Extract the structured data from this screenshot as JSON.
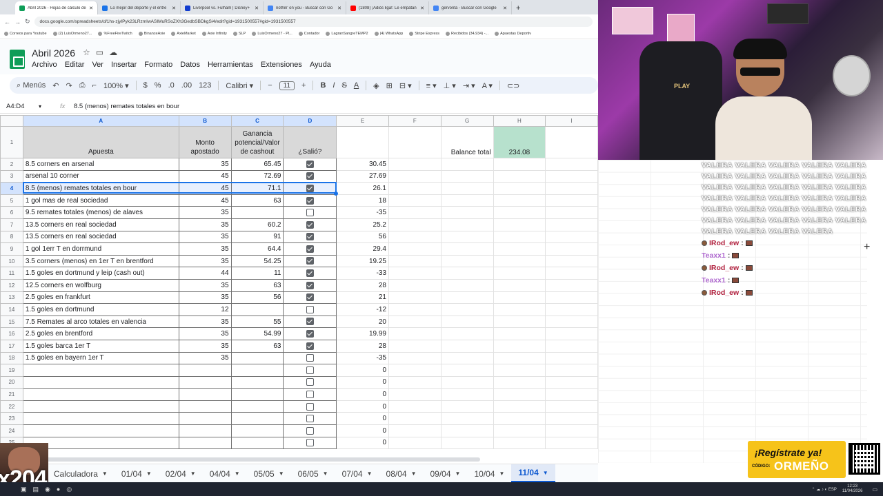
{
  "browser": {
    "tabs": [
      {
        "title": "Abril 2026 - Hojas de cálculo de",
        "active": true
      },
      {
        "title": "Lo mejor del deporte y el entre",
        "active": false
      },
      {
        "title": "Liverpool vs. Fulham | Disney+",
        "active": false
      },
      {
        "title": "nothin' on you - Buscar con Go",
        "active": false
      },
      {
        "title": "(1808) ¡Adiós liga!: Le empatan",
        "active": false
      },
      {
        "title": "gervonta - Buscar con Google",
        "active": false
      }
    ],
    "url": "docs.google.com/spreadsheets/d/1hs-zjyIPyk23LRzmIwASIMuRSoZXh3GedbSBDkgSi4/edit?gid=1931500557#gid=1931500557",
    "bookmarks": [
      "Correos para Youtube",
      "(2) LuisOrmeno27...",
      "%FreeFireTwitch",
      "BinanceAxie",
      "AxieMarket",
      "Axie Infinity",
      "SLP",
      "LuisOrmeno27 - Pl...",
      "Contador",
      "LagranSangreTEMP2",
      "(4) WhatsApp",
      "Stripe Express",
      "Recibidos (34,934) -...",
      "Apuestas Deportiv"
    ]
  },
  "doc": {
    "title": "Abril 2026",
    "menu": [
      "Archivo",
      "Editar",
      "Ver",
      "Insertar",
      "Formato",
      "Datos",
      "Herramientas",
      "Extensiones",
      "Ayuda"
    ]
  },
  "toolbar": {
    "search": "Menús",
    "zoom": "100%",
    "currency": "$",
    "percent": "%",
    "dec_less": ".0",
    "dec_more": ".00",
    "num_format": "123",
    "font": "Calibri",
    "font_size": "11",
    "bold": "B",
    "italic": "I",
    "underline": "A"
  },
  "formula_bar": {
    "cell_ref": "A4:D4",
    "fx": "fx",
    "content": "8.5 (menos) remates totales en bour"
  },
  "grid": {
    "columns": [
      "A",
      "B",
      "C",
      "D",
      "E",
      "F",
      "G",
      "H",
      "I"
    ],
    "header_row": {
      "row": "1",
      "apuesta": "Apuesta",
      "monto": "Monto apostado",
      "ganancia": "Ganancia potencial/Valor de cashout",
      "salio": "¿Salió?",
      "balance_label": "Balance total",
      "balance_value": "234.08"
    },
    "rows": [
      {
        "row": "2",
        "apuesta": "8.5 corners en arsenal",
        "monto": "35",
        "ganancia": "65.45",
        "salio": true,
        "e": "30.45"
      },
      {
        "row": "3",
        "apuesta": "arsenal 10 corner",
        "monto": "45",
        "ganancia": "72.69",
        "salio": true,
        "e": "27.69"
      },
      {
        "row": "4",
        "apuesta": "8.5 (menos) remates totales en bour",
        "monto": "45",
        "ganancia": "71.1",
        "salio": true,
        "e": "26.1"
      },
      {
        "row": "5",
        "apuesta": "1 gol mas de real sociedad",
        "monto": "45",
        "ganancia": "63",
        "salio": true,
        "e": "18"
      },
      {
        "row": "6",
        "apuesta": "9.5 remates totales (menos) de alaves",
        "monto": "35",
        "ganancia": "",
        "salio": false,
        "e": "-35"
      },
      {
        "row": "7",
        "apuesta": "13.5 corners  en real sociedad",
        "monto": "35",
        "ganancia": "60.2",
        "salio": true,
        "e": "25.2"
      },
      {
        "row": "8",
        "apuesta": "13.5 corners  en real sociedad",
        "monto": "35",
        "ganancia": "91",
        "salio": true,
        "e": "56"
      },
      {
        "row": "9",
        "apuesta": "1 gol 1err T en dorrmund",
        "monto": "35",
        "ganancia": "64.4",
        "salio": true,
        "e": "29.4"
      },
      {
        "row": "10",
        "apuesta": "3.5 corners (menos) en 1er T en brentford",
        "monto": "35",
        "ganancia": "54.25",
        "salio": true,
        "e": "19.25"
      },
      {
        "row": "11",
        "apuesta": "1.5 goles en dortmund y leip (cash out)",
        "monto": "44",
        "ganancia": "11",
        "salio": true,
        "e": "-33"
      },
      {
        "row": "12",
        "apuesta": "12.5 corners en wolfburg",
        "monto": "35",
        "ganancia": "63",
        "salio": true,
        "e": "28"
      },
      {
        "row": "13",
        "apuesta": "2.5 goles en frankfurt",
        "monto": "35",
        "ganancia": "56",
        "salio": true,
        "e": "21"
      },
      {
        "row": "14",
        "apuesta": "1.5 goles en dortmund",
        "monto": "12",
        "ganancia": "",
        "salio": false,
        "e": "-12"
      },
      {
        "row": "15",
        "apuesta": "7.5 Remates al arco totales en valencia",
        "monto": "35",
        "ganancia": "55",
        "salio": true,
        "e": "20"
      },
      {
        "row": "16",
        "apuesta": "2.5 goles en brentford",
        "monto": "35",
        "ganancia": "54.99",
        "salio": true,
        "e": "19.99"
      },
      {
        "row": "17",
        "apuesta": "1.5 goles barca 1er T",
        "monto": "35",
        "ganancia": "63",
        "salio": true,
        "e": "28"
      },
      {
        "row": "18",
        "apuesta": "1.5 goles en bayern 1er T",
        "monto": "35",
        "ganancia": "",
        "salio": false,
        "e": "-35"
      },
      {
        "row": "19",
        "apuesta": "",
        "monto": "",
        "ganancia": "",
        "salio": false,
        "e": "0"
      },
      {
        "row": "20",
        "apuesta": "",
        "monto": "",
        "ganancia": "",
        "salio": false,
        "e": "0"
      },
      {
        "row": "21",
        "apuesta": "",
        "monto": "",
        "ganancia": "",
        "salio": false,
        "e": "0"
      },
      {
        "row": "22",
        "apuesta": "",
        "monto": "",
        "ganancia": "",
        "salio": false,
        "e": "0"
      },
      {
        "row": "23",
        "apuesta": "",
        "monto": "",
        "ganancia": "",
        "salio": false,
        "e": "0"
      },
      {
        "row": "24",
        "apuesta": "",
        "monto": "",
        "ganancia": "",
        "salio": false,
        "e": "0"
      },
      {
        "row": "25",
        "apuesta": "",
        "monto": "",
        "ganancia": "",
        "salio": false,
        "e": "0"
      }
    ]
  },
  "sheet_tabs": [
    "Calculadora",
    "01/04",
    "02/04",
    "04/04",
    "05/05",
    "06/05",
    "07/04",
    "08/04",
    "09/04",
    "10/04",
    "11/04"
  ],
  "active_sheet": "11/04",
  "stream": {
    "chat_spam": "VALERA VALERA VALERA VALERA VALERA VALERA VALERA VALERA VALERA VALERA VALERA VALERA VALERA VALERA VALERA VALERA VALERA VALERA VALERA VALERA VALERA VALERA VALERA VALERA VALERA VALERA VALERA VALERA VALERA VALERA VALERA VALERA VALERA VALERA",
    "chat_messages": [
      {
        "user": "IRod_ew",
        "badge": true
      },
      {
        "user": "Teaxx1",
        "badge": false
      },
      {
        "user": "IRod_ew",
        "badge": true
      },
      {
        "user": "Teaxx1",
        "badge": false
      },
      {
        "user": "IRod_ew",
        "badge": true
      }
    ],
    "chat_colon": ":",
    "promo_line": "¡Regístrate ya!",
    "promo_code_label": "CÓDIGO:",
    "promo_code": "ORMEÑO",
    "multiplier": "x204",
    "webcam_text": "PLAY",
    "clock_time": "12:23",
    "clock_date": "11/04/2026",
    "lang": "ESP"
  }
}
